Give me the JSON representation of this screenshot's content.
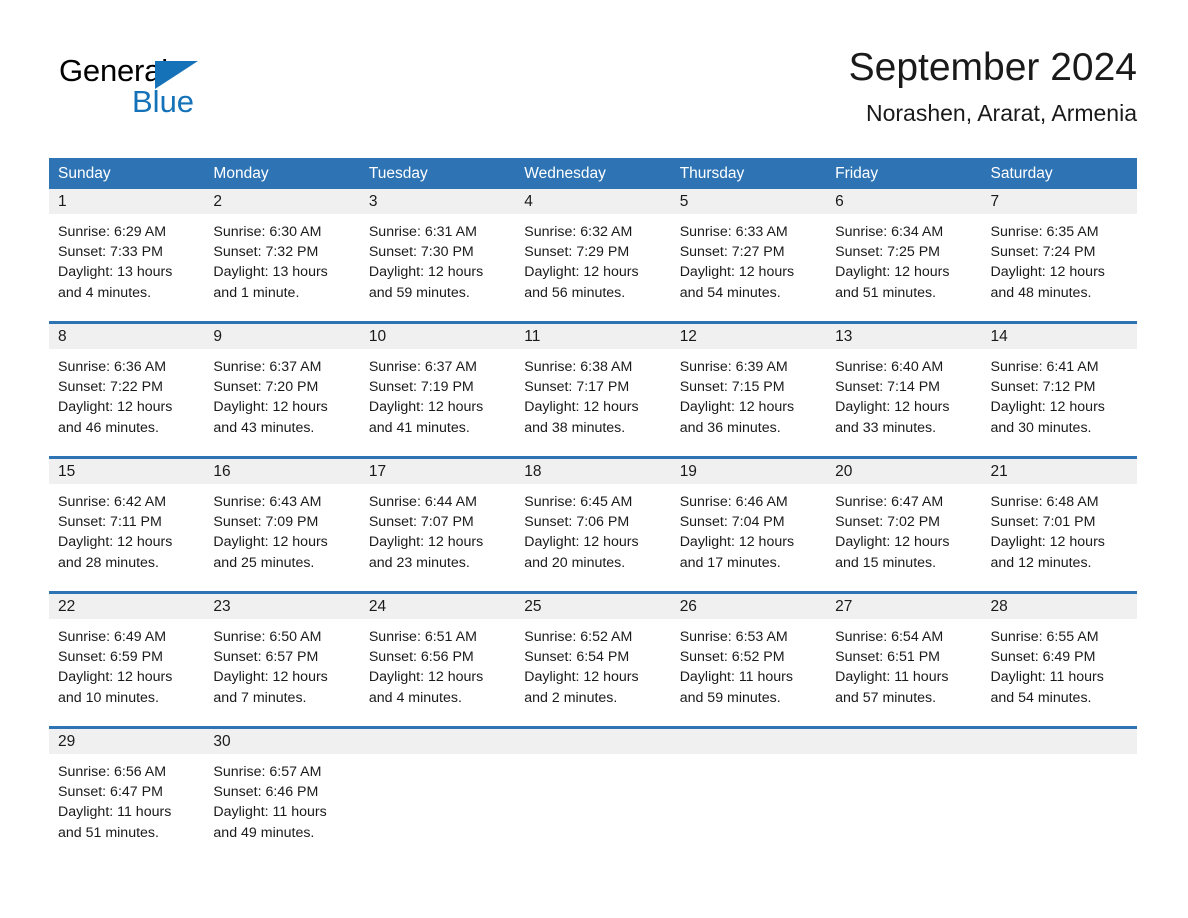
{
  "brand": {
    "name_part1": "General",
    "name_part2": "Blue",
    "logo_icon": "triangle-flag-icon",
    "accent_color": "#1572b9"
  },
  "header": {
    "title": "September 2024",
    "subtitle": "Norashen, Ararat, Armenia"
  },
  "theme": {
    "header_blue": "#2e74b5",
    "day_band_gray": "#f0f0f0",
    "text_color": "#1a1a1a"
  },
  "weekdays": [
    "Sunday",
    "Monday",
    "Tuesday",
    "Wednesday",
    "Thursday",
    "Friday",
    "Saturday"
  ],
  "weeks": [
    [
      {
        "day": "1",
        "sunrise": "Sunrise: 6:29 AM",
        "sunset": "Sunset: 7:33 PM",
        "daylight": "Daylight: 13 hours and 4 minutes."
      },
      {
        "day": "2",
        "sunrise": "Sunrise: 6:30 AM",
        "sunset": "Sunset: 7:32 PM",
        "daylight": "Daylight: 13 hours and 1 minute."
      },
      {
        "day": "3",
        "sunrise": "Sunrise: 6:31 AM",
        "sunset": "Sunset: 7:30 PM",
        "daylight": "Daylight: 12 hours and 59 minutes."
      },
      {
        "day": "4",
        "sunrise": "Sunrise: 6:32 AM",
        "sunset": "Sunset: 7:29 PM",
        "daylight": "Daylight: 12 hours and 56 minutes."
      },
      {
        "day": "5",
        "sunrise": "Sunrise: 6:33 AM",
        "sunset": "Sunset: 7:27 PM",
        "daylight": "Daylight: 12 hours and 54 minutes."
      },
      {
        "day": "6",
        "sunrise": "Sunrise: 6:34 AM",
        "sunset": "Sunset: 7:25 PM",
        "daylight": "Daylight: 12 hours and 51 minutes."
      },
      {
        "day": "7",
        "sunrise": "Sunrise: 6:35 AM",
        "sunset": "Sunset: 7:24 PM",
        "daylight": "Daylight: 12 hours and 48 minutes."
      }
    ],
    [
      {
        "day": "8",
        "sunrise": "Sunrise: 6:36 AM",
        "sunset": "Sunset: 7:22 PM",
        "daylight": "Daylight: 12 hours and 46 minutes."
      },
      {
        "day": "9",
        "sunrise": "Sunrise: 6:37 AM",
        "sunset": "Sunset: 7:20 PM",
        "daylight": "Daylight: 12 hours and 43 minutes."
      },
      {
        "day": "10",
        "sunrise": "Sunrise: 6:37 AM",
        "sunset": "Sunset: 7:19 PM",
        "daylight": "Daylight: 12 hours and 41 minutes."
      },
      {
        "day": "11",
        "sunrise": "Sunrise: 6:38 AM",
        "sunset": "Sunset: 7:17 PM",
        "daylight": "Daylight: 12 hours and 38 minutes."
      },
      {
        "day": "12",
        "sunrise": "Sunrise: 6:39 AM",
        "sunset": "Sunset: 7:15 PM",
        "daylight": "Daylight: 12 hours and 36 minutes."
      },
      {
        "day": "13",
        "sunrise": "Sunrise: 6:40 AM",
        "sunset": "Sunset: 7:14 PM",
        "daylight": "Daylight: 12 hours and 33 minutes."
      },
      {
        "day": "14",
        "sunrise": "Sunrise: 6:41 AM",
        "sunset": "Sunset: 7:12 PM",
        "daylight": "Daylight: 12 hours and 30 minutes."
      }
    ],
    [
      {
        "day": "15",
        "sunrise": "Sunrise: 6:42 AM",
        "sunset": "Sunset: 7:11 PM",
        "daylight": "Daylight: 12 hours and 28 minutes."
      },
      {
        "day": "16",
        "sunrise": "Sunrise: 6:43 AM",
        "sunset": "Sunset: 7:09 PM",
        "daylight": "Daylight: 12 hours and 25 minutes."
      },
      {
        "day": "17",
        "sunrise": "Sunrise: 6:44 AM",
        "sunset": "Sunset: 7:07 PM",
        "daylight": "Daylight: 12 hours and 23 minutes."
      },
      {
        "day": "18",
        "sunrise": "Sunrise: 6:45 AM",
        "sunset": "Sunset: 7:06 PM",
        "daylight": "Daylight: 12 hours and 20 minutes."
      },
      {
        "day": "19",
        "sunrise": "Sunrise: 6:46 AM",
        "sunset": "Sunset: 7:04 PM",
        "daylight": "Daylight: 12 hours and 17 minutes."
      },
      {
        "day": "20",
        "sunrise": "Sunrise: 6:47 AM",
        "sunset": "Sunset: 7:02 PM",
        "daylight": "Daylight: 12 hours and 15 minutes."
      },
      {
        "day": "21",
        "sunrise": "Sunrise: 6:48 AM",
        "sunset": "Sunset: 7:01 PM",
        "daylight": "Daylight: 12 hours and 12 minutes."
      }
    ],
    [
      {
        "day": "22",
        "sunrise": "Sunrise: 6:49 AM",
        "sunset": "Sunset: 6:59 PM",
        "daylight": "Daylight: 12 hours and 10 minutes."
      },
      {
        "day": "23",
        "sunrise": "Sunrise: 6:50 AM",
        "sunset": "Sunset: 6:57 PM",
        "daylight": "Daylight: 12 hours and 7 minutes."
      },
      {
        "day": "24",
        "sunrise": "Sunrise: 6:51 AM",
        "sunset": "Sunset: 6:56 PM",
        "daylight": "Daylight: 12 hours and 4 minutes."
      },
      {
        "day": "25",
        "sunrise": "Sunrise: 6:52 AM",
        "sunset": "Sunset: 6:54 PM",
        "daylight": "Daylight: 12 hours and 2 minutes."
      },
      {
        "day": "26",
        "sunrise": "Sunrise: 6:53 AM",
        "sunset": "Sunset: 6:52 PM",
        "daylight": "Daylight: 11 hours and 59 minutes."
      },
      {
        "day": "27",
        "sunrise": "Sunrise: 6:54 AM",
        "sunset": "Sunset: 6:51 PM",
        "daylight": "Daylight: 11 hours and 57 minutes."
      },
      {
        "day": "28",
        "sunrise": "Sunrise: 6:55 AM",
        "sunset": "Sunset: 6:49 PM",
        "daylight": "Daylight: 11 hours and 54 minutes."
      }
    ],
    [
      {
        "day": "29",
        "sunrise": "Sunrise: 6:56 AM",
        "sunset": "Sunset: 6:47 PM",
        "daylight": "Daylight: 11 hours and 51 minutes."
      },
      {
        "day": "30",
        "sunrise": "Sunrise: 6:57 AM",
        "sunset": "Sunset: 6:46 PM",
        "daylight": "Daylight: 11 hours and 49 minutes."
      },
      {
        "day": "",
        "sunrise": "",
        "sunset": "",
        "daylight": ""
      },
      {
        "day": "",
        "sunrise": "",
        "sunset": "",
        "daylight": ""
      },
      {
        "day": "",
        "sunrise": "",
        "sunset": "",
        "daylight": ""
      },
      {
        "day": "",
        "sunrise": "",
        "sunset": "",
        "daylight": ""
      },
      {
        "day": "",
        "sunrise": "",
        "sunset": "",
        "daylight": ""
      }
    ]
  ]
}
